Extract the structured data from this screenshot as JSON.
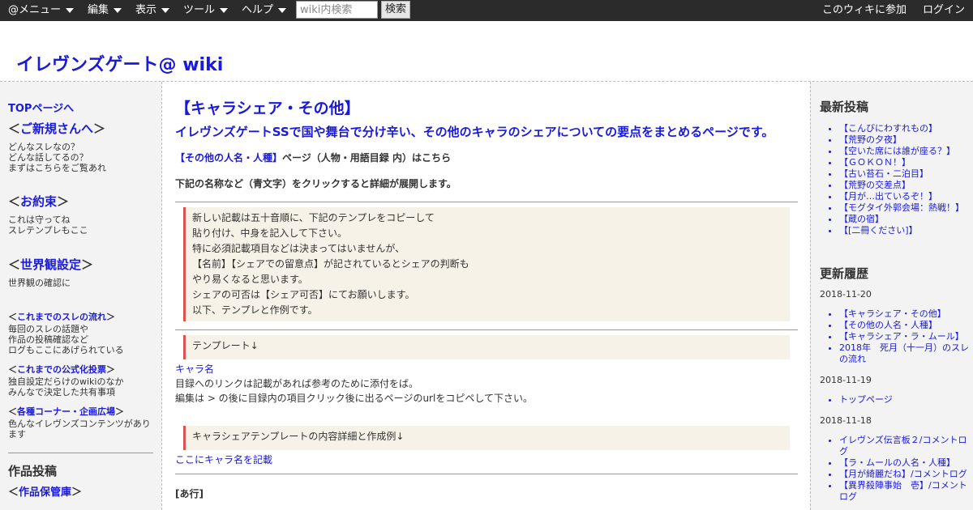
{
  "topbar": {
    "menus": [
      "@メニュー",
      "編集",
      "表示",
      "ツール",
      "ヘルプ"
    ],
    "search_placeholder": "wiki内検索",
    "search_button": "検索",
    "join": "このウィキに参加",
    "login": "ログイン"
  },
  "site": {
    "title": "イレヴンズゲート@ wiki"
  },
  "left": {
    "top_link": "TOPページへ",
    "newcomer": {
      "head": "＜ご新規さんへ＞",
      "link": "ご新規さんへ",
      "lines": [
        "どんなスレなの？",
        "どんな話してるの？",
        "まずはこちらをご覧あれ"
      ]
    },
    "rules": {
      "head": "＜お約束＞",
      "link": "お約束",
      "lines": [
        "これは守ってね",
        "スレテンプレもここ"
      ]
    },
    "world": {
      "head": "＜世界観設定＞",
      "link": "世界観設定",
      "lines": [
        "世界観の確認に"
      ]
    },
    "flow": {
      "link": "これまでのスレの流れ",
      "lines": [
        "毎回のスレの話題や",
        "作品の投稿確認など",
        "ログもここにあげられている"
      ]
    },
    "votes": {
      "link": "これまでの公式化投票",
      "lines": [
        "独自設定だらけのwikiのなか",
        "みんなで決定した共有事項"
      ]
    },
    "corners": {
      "link": "各種コーナー・企画広場",
      "lines": [
        "色んなイレヴンズコンテンツがあり",
        "ます"
      ]
    },
    "works_title": "作品投稿",
    "archive_link": "作品保管庫"
  },
  "main": {
    "title": "【キャラシェア・その他】",
    "subtitle": "イレヴンズゲートSSで国や舞台で分け辛い、その他のキャラのシェアについての要点をまとめるページです。",
    "names_link": "【その他の人名・人種】",
    "names_suffix": "ページ（人物・用語目録 内）はこちら",
    "click_note": "下記の名称など（青文字）をクリックすると詳細が展開します。",
    "notice_lines": [
      "新しい記載は五十音順に、下記のテンプレをコピーして",
      "貼り付け、中身を記入して下さい。",
      "特に必須記載項目などは決まってはいませんが、",
      "【名前】【シェアでの留意点】が記されているとシェアの判断も",
      "やり易くなると思います。",
      "シェアの可否は【シェア可否】にてお願いします。",
      "以下、テンプレと作例です。"
    ],
    "template_label": "テンプレート↓",
    "chara_name": "キャラ名",
    "template_lines": [
      "目録へのリンクは記載があれば参考のために添付をば。",
      "編集は > の後に目録内の項目クリック後に出るページのurlをコピペして下さい。"
    ],
    "detail_label": "キャラシェアテンプレートの内容詳細と作成例↓",
    "detail_link": "ここにキャラ名を記載",
    "section_a": "[あ行]"
  },
  "right": {
    "latest_title": "最新投稿",
    "latest": [
      "【こんびにわすれもの】",
      "【荒野の夕夜】",
      "【空いた席には誰が座る？】",
      "【ＧＯＫＯＮ！】",
      "【古い苔石・二泊目】",
      "【荒野の交差点】",
      "【月が…出ているぞ！】",
      "【モグタイ外郭会場：熱戦！】",
      "【蔵の宿】",
      "【[二冊ください]】"
    ],
    "history_title": "更新履歴",
    "history": [
      {
        "date": "2018-11-20",
        "items": [
          "【キャラシェア・その他】",
          "【その他の人名・人種】",
          "【キャラシェア・ラ・ムール】",
          "2018年　死月（十一月）のスレの流れ"
        ]
      },
      {
        "date": "2018-11-19",
        "items": [
          "トップページ"
        ]
      },
      {
        "date": "2018-11-18",
        "items": [
          "イレヴンズ伝言板２/コメントログ",
          "【ラ・ムールの人名・人種】",
          "【月が綺麗だね】/コメントログ",
          "【異界殺陣事始　壱】/コメントログ"
        ]
      }
    ]
  }
}
